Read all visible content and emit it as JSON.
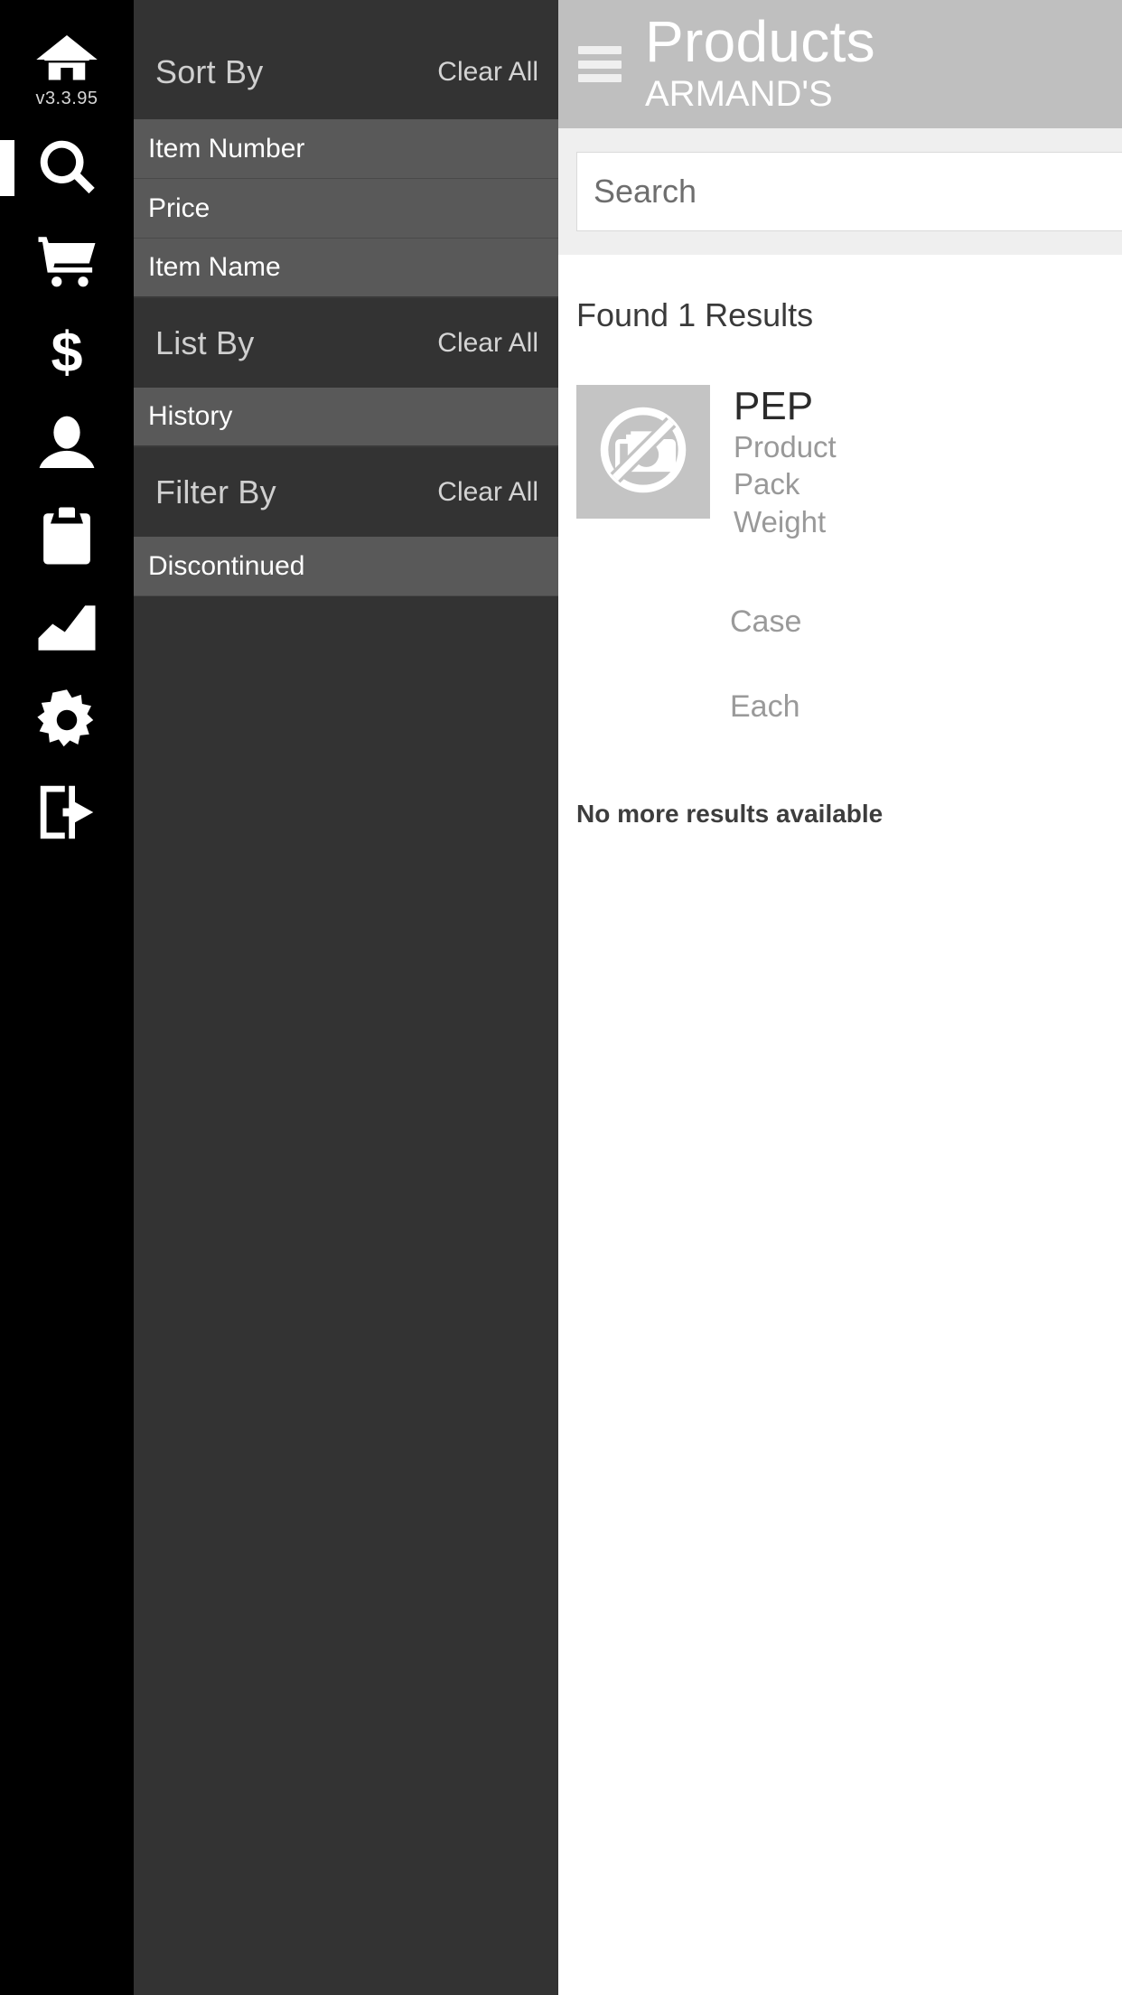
{
  "rail": {
    "version_label": "v3.3.95",
    "items": [
      {
        "icon": "home-icon",
        "name": "home"
      },
      {
        "icon": "search-icon",
        "name": "search"
      },
      {
        "icon": "cart-icon",
        "name": "cart"
      },
      {
        "icon": "dollar-icon",
        "name": "pricing"
      },
      {
        "icon": "user-icon",
        "name": "account"
      },
      {
        "icon": "clipboard-icon",
        "name": "orders"
      },
      {
        "icon": "chart-icon",
        "name": "reports"
      },
      {
        "icon": "gear-icon",
        "name": "settings"
      },
      {
        "icon": "logout-icon",
        "name": "logout"
      }
    ]
  },
  "drawer": {
    "groups": [
      {
        "title": "Sort By",
        "clear_label": "Clear All",
        "items": [
          "Item Number",
          "Price",
          "Item Name"
        ]
      },
      {
        "title": "List By",
        "clear_label": "Clear All",
        "items": [
          "History"
        ]
      },
      {
        "title": "Filter By",
        "clear_label": "Clear All",
        "items": [
          "Discontinued"
        ]
      }
    ]
  },
  "header": {
    "title": "Products",
    "subtitle": "ARMAND'S",
    "menu_icon": "hamburger-icon"
  },
  "search": {
    "placeholder": "Search",
    "value": ""
  },
  "results": {
    "count_label": "Found 1 Results",
    "footer_label": "No more results available",
    "product": {
      "image_placeholder_icon": "no-photo-icon",
      "name": "PEP",
      "line_product": "Product",
      "line_pack": "Pack",
      "line_weight": "Weight",
      "uom_case": "Case",
      "uom_each": "Each"
    }
  },
  "colors": {
    "rail_bg": "#000000",
    "drawer_group_bg": "#333333",
    "drawer_item_bg": "#595959",
    "header_bg": "#bfbfbf",
    "content_bg": "#ffffff",
    "thumb_bg": "#c4c4c4"
  }
}
